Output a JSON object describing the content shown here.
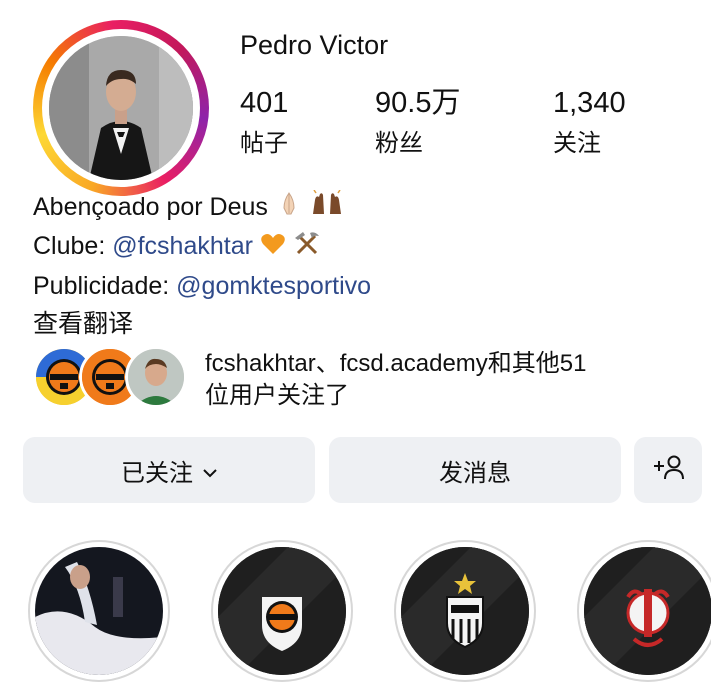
{
  "profile": {
    "username": "Pedro Victor",
    "stats": [
      {
        "value": "401",
        "label": "帖子"
      },
      {
        "value": "90.5万",
        "label": "粉丝"
      },
      {
        "value": "1,340",
        "label": "关注"
      }
    ]
  },
  "bio": {
    "line1": "Abençoado por Deus",
    "line2_prefix": "Clube: ",
    "line2_mention": "@fcshakhtar",
    "line3_prefix": "Publicidade: ",
    "line3_mention": "@gomktesportivo",
    "translate": "查看翻译"
  },
  "followed_by": {
    "line1": "fcshakhtar、fcsd.academy和其他51",
    "line2": "位用户关注了"
  },
  "actions": {
    "following_label": "已关注",
    "message_label": "发消息"
  },
  "icons": {
    "add_person": "add-person-icon",
    "dropdown": "chevron-down-icon"
  },
  "colors": {
    "mention": "#2f4a8a",
    "button_bg": "#eef0f3",
    "shakhtar_orange": "#f07a1a"
  }
}
